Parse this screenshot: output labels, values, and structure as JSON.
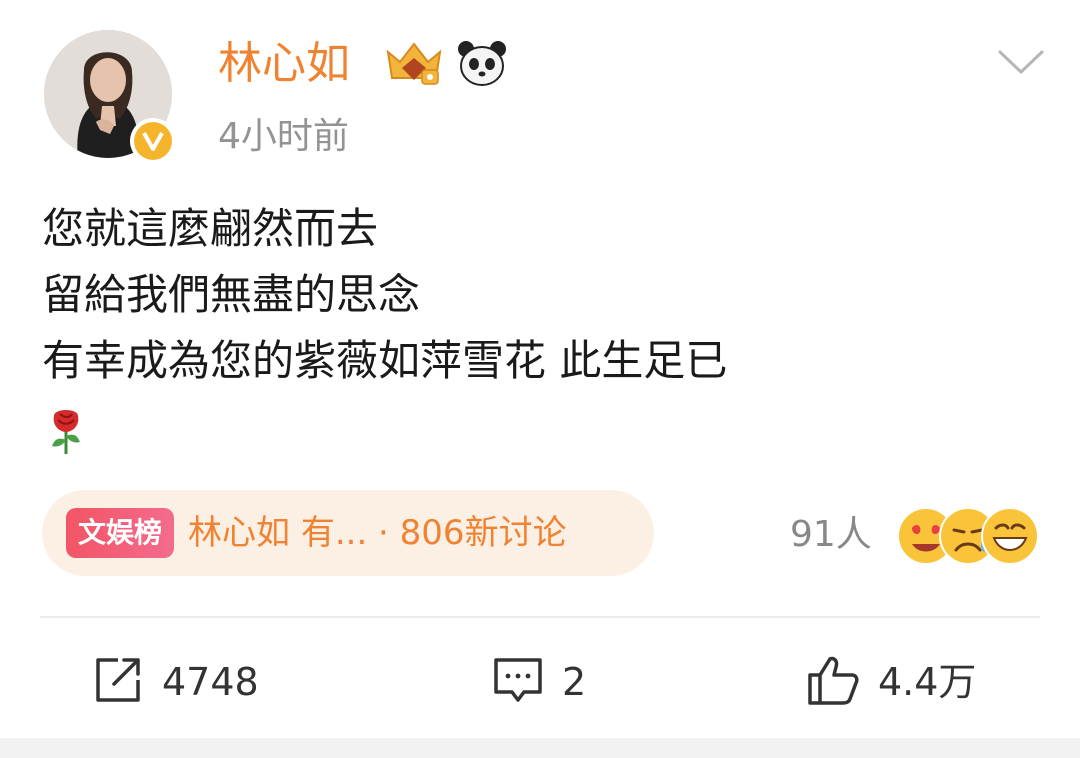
{
  "post": {
    "author": "林心如",
    "timestamp": "4小时前",
    "lines": [
      "您就這麼翩然而去",
      "留給我們無盡的思念",
      "有幸成為您的紫薇如萍雪花  此生足已"
    ]
  },
  "topic": {
    "tag": "文娱榜",
    "text": "林心如 有... · 806新讨论"
  },
  "reactions": {
    "count": "91人"
  },
  "actions": {
    "repost": "4748",
    "comment": "2",
    "like": "4.4万"
  },
  "icons": {
    "header": [
      "crown-icon",
      "panda-icon",
      "chevron-down-icon",
      "verified-badge-icon"
    ],
    "actions": [
      "repost-icon",
      "comment-icon",
      "like-icon"
    ],
    "post": [
      "rose-icon"
    ]
  },
  "colors": {
    "username": "#f08332",
    "verified": "#f4b52d",
    "topic_bg": "#fcefe4",
    "tag_bg": "#f25565"
  }
}
